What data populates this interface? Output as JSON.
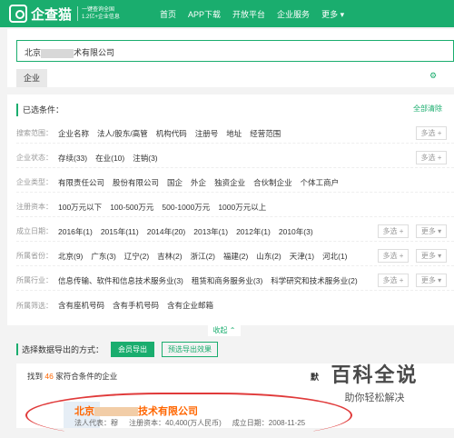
{
  "nav": {
    "brand": "企查猫",
    "tagline_1": "一键查询全国",
    "tagline_2": "1.2亿+企业信息",
    "links": [
      "首页",
      "APP下载",
      "开放平台",
      "企业服务"
    ],
    "more": "更多 ▾"
  },
  "search": {
    "prefix": "北京",
    "suffix": "术有限公司"
  },
  "tabs": {
    "enterprise": "企业"
  },
  "panel": {
    "settings": "⚙"
  },
  "filters": {
    "heading": "已选条件：",
    "clear_all": "全部清除",
    "rows": [
      {
        "label": "搜索范围：",
        "options": [
          "企业名称",
          "法人/股东/高管",
          "机构代码",
          "注册号",
          "地址",
          "经营范围"
        ]
      },
      {
        "label": "企业状态：",
        "options": [
          "存续(33)",
          "在业(10)",
          "注销(3)"
        ]
      },
      {
        "label": "企业类型：",
        "options": [
          "有限责任公司",
          "股份有限公司",
          "国企",
          "外企",
          "独资企业",
          "合伙制企业",
          "个体工商户"
        ]
      },
      {
        "label": "注册资本：",
        "options": [
          "100万元以下",
          "100-500万元",
          "500-1000万元",
          "1000万元以上"
        ]
      },
      {
        "label": "成立日期：",
        "options": [
          "2016年(1)",
          "2015年(11)",
          "2014年(20)",
          "2013年(1)",
          "2012年(1)",
          "2010年(3)"
        ]
      },
      {
        "label": "所属省份：",
        "options": [
          "北京(9)",
          "广东(3)",
          "辽宁(2)",
          "吉林(2)",
          "浙江(2)",
          "福建(2)",
          "山东(2)",
          "天津(1)",
          "河北(1)"
        ]
      },
      {
        "label": "所属行业：",
        "options": [
          "信息传输、软件和信息技术服务业(3)",
          "租赁和商务服务业(3)",
          "科学研究和技术服务业(2)"
        ]
      },
      {
        "label": "所属筛选：",
        "options": [
          "含有座机号码",
          "含有手机号码",
          "含有企业邮箱"
        ]
      }
    ],
    "multi": "多选 +",
    "more": "更多 ▾",
    "collapse": "收起 ⌃"
  },
  "export": {
    "label": "选择数据导出的方式：",
    "member": "会员导出",
    "preview": "预选导出效果"
  },
  "results": {
    "prefix": "找到",
    "count": "46",
    "suffix": "家符合条件的企业",
    "sort": "默"
  },
  "company": {
    "name_prefix": "北京",
    "name_suffix": "技术有限公司",
    "legal": "法人代表：穆",
    "capital": "注册资本：40,400(万人民币)",
    "founded": "成立日期：2008-11-25"
  },
  "watermark": {
    "main": "百科全说",
    "sub": "助你轻松解决"
  }
}
